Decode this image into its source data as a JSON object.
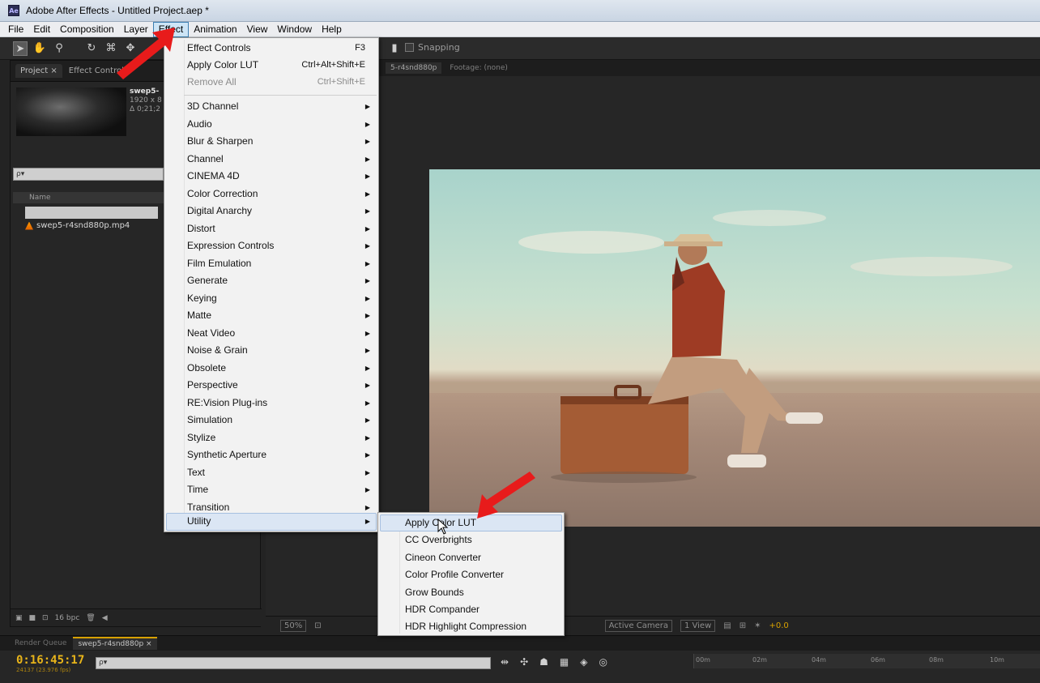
{
  "window": {
    "title": "Adobe After Effects - Untitled Project.aep *",
    "app_icon": "Ae"
  },
  "menubar": [
    "File",
    "Edit",
    "Composition",
    "Layer",
    "Effect",
    "Animation",
    "View",
    "Window",
    "Help"
  ],
  "toolbar": {
    "snapping_label": "Snapping"
  },
  "project_panel": {
    "tabs": [
      "Project ×",
      "Effect Controls"
    ],
    "thumb_filename": "swep5-",
    "thumb_size": "1920 x 8",
    "thumb_duration": "Δ 0;21;2",
    "search_placeholder": "ρ▾",
    "column_name": "Name",
    "file_item": "swep5-r4snd880p.mp4",
    "bpc_label": "16 bpc"
  },
  "viewer": {
    "tab_comp": "5-r4snd880p",
    "tab_footage": "Footage: (none)",
    "zoom": "50%",
    "active_camera": "Active Camera",
    "view_count": "1 View",
    "exposure": "+0.0"
  },
  "timeline": {
    "tabs": [
      "Render Queue",
      "swep5-r4snd880p ×"
    ],
    "timecode": "0:16:45:17",
    "fps": "24137 (23.976 fps)",
    "search_placeholder": "ρ▾",
    "ruler_labels": [
      "00m",
      "02m",
      "04m",
      "06m",
      "08m",
      "10m"
    ]
  },
  "effect_menu": {
    "top_items": [
      {
        "label": "Effect Controls",
        "shortcut": "F3",
        "disabled": false
      },
      {
        "label": "Apply Color LUT",
        "shortcut": "Ctrl+Alt+Shift+E",
        "disabled": false
      },
      {
        "label": "Remove All",
        "shortcut": "Ctrl+Shift+E",
        "disabled": true
      }
    ],
    "categories": [
      "3D Channel",
      "Audio",
      "Blur & Sharpen",
      "Channel",
      "CINEMA 4D",
      "Color Correction",
      "Digital Anarchy",
      "Distort",
      "Expression Controls",
      "Film Emulation",
      "Generate",
      "Keying",
      "Matte",
      "Neat Video",
      "Noise & Grain",
      "Obsolete",
      "Perspective",
      "RE:Vision Plug-ins",
      "Simulation",
      "Stylize",
      "Synthetic Aperture",
      "Text",
      "Time",
      "Transition",
      "Utility"
    ],
    "highlighted": "Utility"
  },
  "utility_submenu": {
    "items": [
      "Apply Color LUT",
      "CC Overbrights",
      "Cineon Converter",
      "Color Profile Converter",
      "Grow Bounds",
      "HDR Compander",
      "HDR Highlight Compression"
    ],
    "highlighted": "Apply Color LUT"
  },
  "colors": {
    "highlight": "#dbe6f4",
    "timecode": "#e8b41a",
    "arrow": "#e81b1b",
    "menu_bg": "#f2f2f2"
  }
}
